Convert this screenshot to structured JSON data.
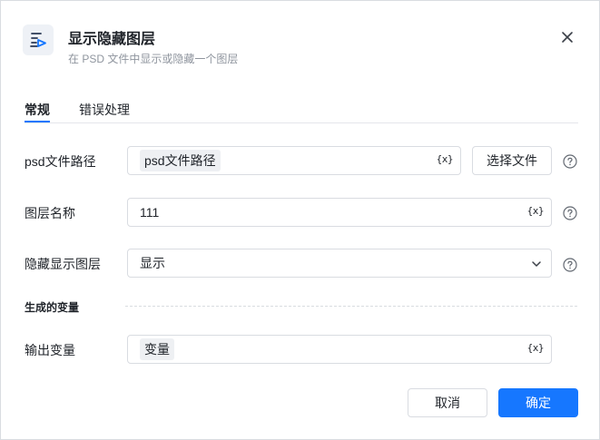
{
  "header": {
    "title": "显示隐藏图层",
    "subtitle": "在 PSD 文件中显示或隐藏一个图层",
    "logo_icon": "layers-eye-icon",
    "close_icon": "close-icon"
  },
  "tabs": [
    {
      "label": "常规",
      "active": true
    },
    {
      "label": "错误处理",
      "active": false
    }
  ],
  "form": {
    "psd_path": {
      "label": "psd文件路径",
      "value": "psd文件路径",
      "var_icon": "{x}",
      "select_file_label": "选择文件"
    },
    "layer_name": {
      "label": "图层名称",
      "value": "111",
      "var_icon": "{x}"
    },
    "visibility": {
      "label": "隐藏显示图层",
      "value": "显示"
    }
  },
  "output_section": {
    "title": "生成的变量",
    "output_var": {
      "label": "输出变量",
      "value": "变量",
      "var_icon": "{x}"
    }
  },
  "footer": {
    "cancel_label": "取消",
    "ok_label": "确定"
  },
  "colors": {
    "accent": "#1677ff",
    "border": "#d9dce1",
    "chip_bg": "#eef0f3",
    "muted_text": "#8f959e"
  }
}
